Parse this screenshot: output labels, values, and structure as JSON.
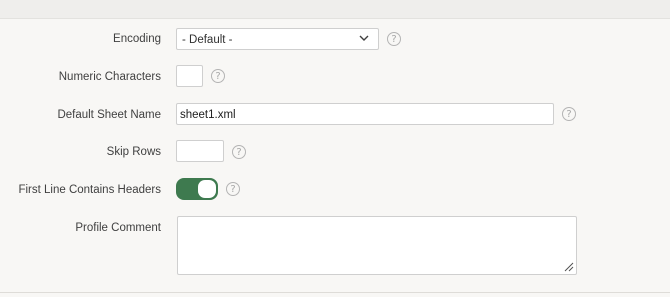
{
  "form": {
    "encoding": {
      "label": "Encoding",
      "selected": "- Default -",
      "help_icon": "help-circle-icon",
      "dropdown_icon": "chevron-down-icon"
    },
    "numeric_characters": {
      "label": "Numeric Characters",
      "value": "",
      "help_icon": "help-circle-icon"
    },
    "default_sheet_name": {
      "label": "Default Sheet Name",
      "value": "sheet1.xml",
      "help_icon": "help-circle-icon"
    },
    "skip_rows": {
      "label": "Skip Rows",
      "value": "",
      "help_icon": "help-circle-icon"
    },
    "first_line_headers": {
      "label": "First Line Contains Headers",
      "checked": true,
      "help_icon": "help-circle-icon"
    },
    "profile_comment": {
      "label": "Profile Comment",
      "value": "",
      "resize_icon": "resize-grip-icon"
    }
  },
  "help_glyph": "?",
  "colors": {
    "toggle_on": "#3e7a4f",
    "background": "#f8f7f5",
    "top_bar": "#efeeec"
  }
}
